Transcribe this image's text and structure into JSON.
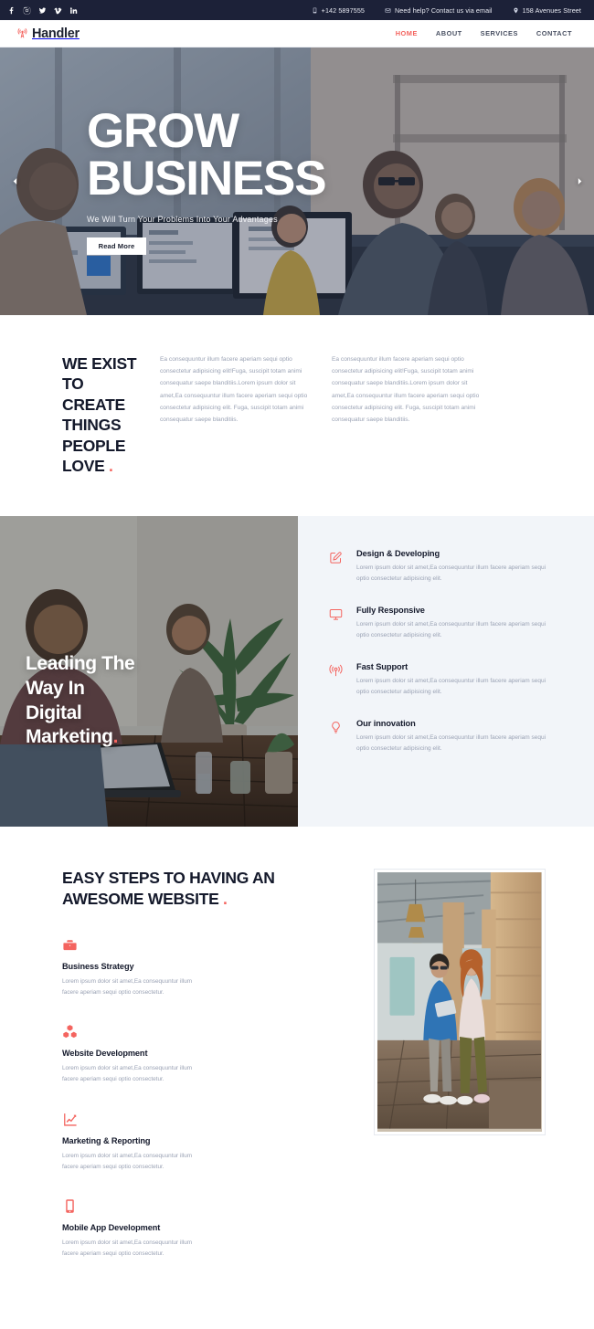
{
  "topbar": {
    "social": [
      {
        "name": "facebook-icon",
        "label": "Facebook"
      },
      {
        "name": "instagram-icon",
        "label": "Instagram"
      },
      {
        "name": "twitter-icon",
        "label": "Twitter"
      },
      {
        "name": "vimeo-icon",
        "label": "Vimeo"
      },
      {
        "name": "linkedin-icon",
        "label": "LinkedIn"
      }
    ],
    "phone": "+142 5897555",
    "email_text": "Need help? Contact us via email",
    "address": "158 Avenues Street"
  },
  "nav": {
    "brand": "Handler",
    "links": [
      {
        "label": "HOME",
        "active": true
      },
      {
        "label": "ABOUT",
        "active": false
      },
      {
        "label": "SERVICES",
        "active": false
      },
      {
        "label": "CONTACT",
        "active": false
      }
    ]
  },
  "hero": {
    "title_line1": "GROW",
    "title_line2": "BUSINESS",
    "subtitle": "We Will Turn Your Problems Into Your Advantages",
    "button": "Read More",
    "prev_label": "Previous slide",
    "next_label": "Next slide"
  },
  "exist": {
    "title_line1": "WE EXIST TO",
    "title_line2": "CREATE THINGS",
    "title_line3": "PEOPLE LOVE",
    "dot": ".",
    "paragraph1": "Ea consequuntur illum facere aperiam sequi optio consectetur adipisicing elit!Fuga, suscipit totam animi consequatur saepe blanditiis.Lorem ipsum dolor sit amet,Ea consequuntur illum facere aperiam sequi optio consectetur adipisicing elit. Fuga, suscipit totam animi consequatur saepe blanditiis.",
    "paragraph2": "Ea consequuntur illum facere aperiam sequi optio consectetur adipisicing elit!Fuga, suscipit totam animi consequatur saepe blanditiis.Lorem ipsum dolor sit amet,Ea consequuntur illum facere aperiam sequi optio consectetur adipisicing elit. Fuga, suscipit totam animi consequatur saepe blanditiis."
  },
  "leading": {
    "caption_line1": "Leading The",
    "caption_line2": "Way In",
    "caption_line3": "Digital",
    "caption_line4": "Marketing",
    "dot": ".",
    "features": [
      {
        "icon": "pencil-square-icon",
        "title": "Design & Developing",
        "desc": "Lorem ipsum dolor sit amet,Ea consequuntur illum facere aperiam sequi optio consectetur adipisicing elit."
      },
      {
        "icon": "monitor-icon",
        "title": "Fully Responsive",
        "desc": "Lorem ipsum dolor sit amet,Ea consequuntur illum facere aperiam sequi optio consectetur adipisicing elit."
      },
      {
        "icon": "broadcast-signal-icon",
        "title": "Fast Support",
        "desc": "Lorem ipsum dolor sit amet,Ea consequuntur illum facere aperiam sequi optio consectetur adipisicing elit."
      },
      {
        "icon": "lightbulb-icon",
        "title": "Our innovation",
        "desc": "Lorem ipsum dolor sit amet,Ea consequuntur illum facere aperiam sequi optio consectetur adipisicing elit."
      }
    ]
  },
  "steps": {
    "title_line1": "EASY STEPS TO HAVING AN",
    "title_line2": "AWESOME WEBSITE",
    "dot": ".",
    "items": [
      {
        "icon": "briefcase-icon",
        "title": "Business Strategy",
        "desc": "Lorem ipsum dolor sit amet,Ea consequuntur illum facere aperiam sequi optio consectetur."
      },
      {
        "icon": "cubes-icon",
        "title": "Website Development",
        "desc": "Lorem ipsum dolor sit amet,Ea consequuntur illum facere aperiam sequi optio consectetur."
      },
      {
        "icon": "chart-line-icon",
        "title": "Marketing & Reporting",
        "desc": "Lorem ipsum dolor sit amet,Ea consequuntur illum facere aperiam sequi optio consectetur."
      },
      {
        "icon": "mobile-phone-icon",
        "title": "Mobile App Development",
        "desc": "Lorem ipsum dolor sit amet,Ea consequuntur illum facere aperiam sequi optio consectetur."
      }
    ]
  },
  "colors": {
    "accent": "#f4645f",
    "dark": "#1c2138",
    "heading": "#14192b",
    "muted": "#9aa2b4",
    "section_bg": "#f2f5f9"
  }
}
